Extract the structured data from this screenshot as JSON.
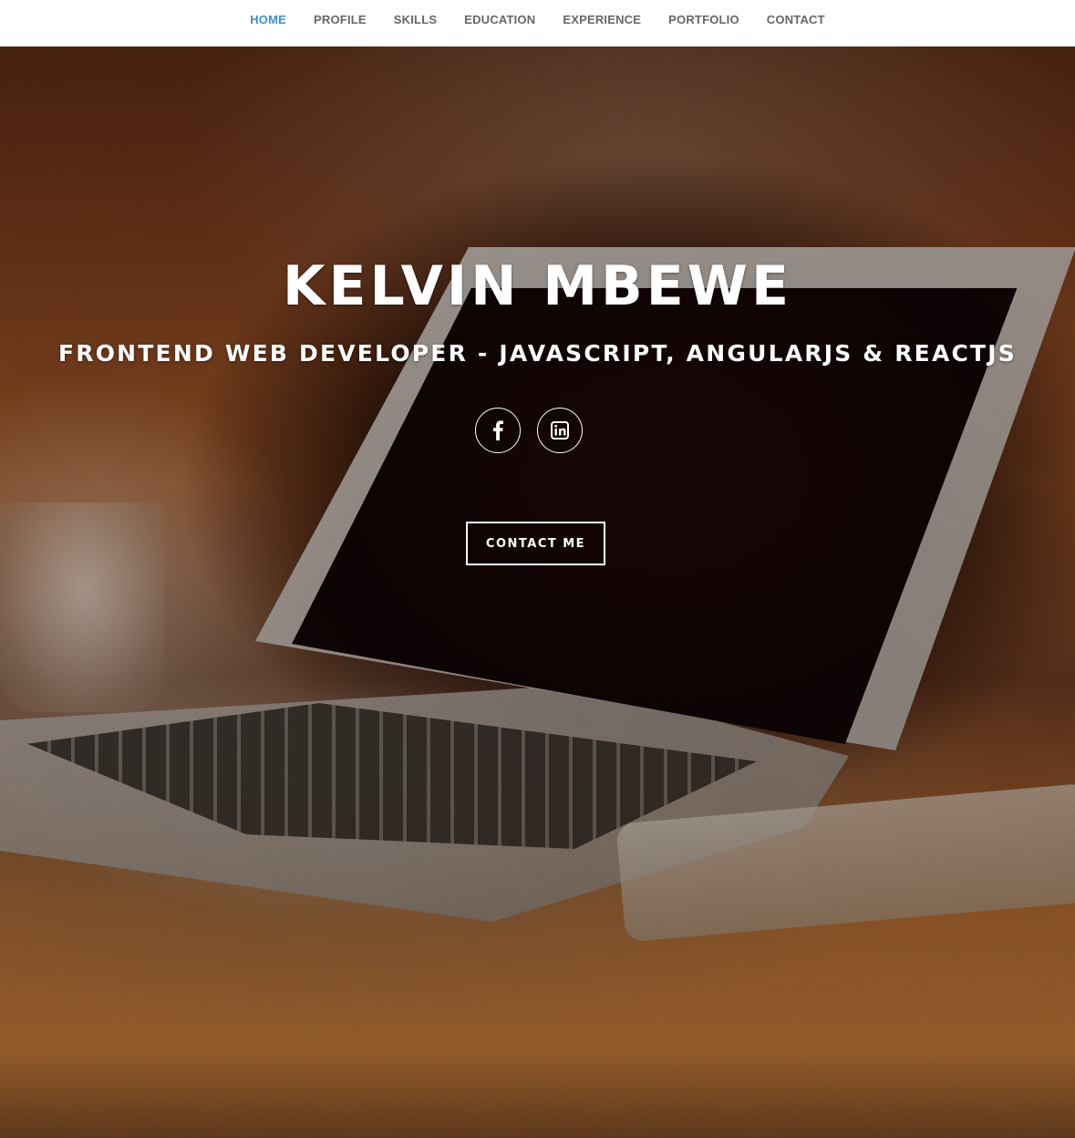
{
  "nav": {
    "items": [
      {
        "label": "HOME",
        "active": true
      },
      {
        "label": "PROFILE",
        "active": false
      },
      {
        "label": "SKILLS",
        "active": false
      },
      {
        "label": "EDUCATION",
        "active": false
      },
      {
        "label": "EXPERIENCE",
        "active": false
      },
      {
        "label": "PORTFOLIO",
        "active": false
      },
      {
        "label": "CONTACT",
        "active": false
      }
    ]
  },
  "hero": {
    "name": "KELVIN MBEWE",
    "subtitle": "FRONTEND WEB DEVELOPER - JAVASCRIPT, ANGULARJS & REACTJS",
    "socials": [
      {
        "icon": "facebook-icon"
      },
      {
        "icon": "linkedin-icon"
      }
    ],
    "cta_label": "CONTACT ME"
  },
  "colors": {
    "nav_active": "#3a8fd6",
    "nav_text": "#666666",
    "nav_bg": "#ffffff",
    "hero_text": "#ffffff"
  }
}
